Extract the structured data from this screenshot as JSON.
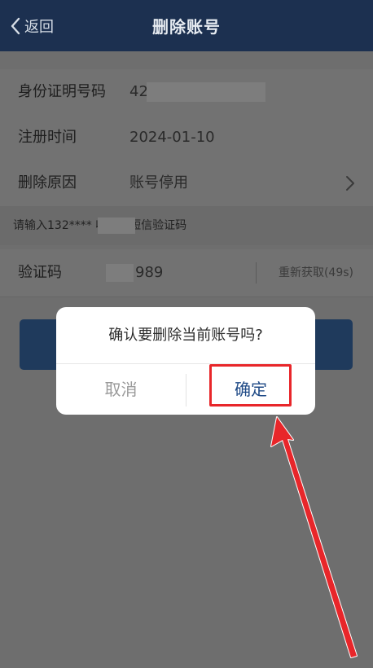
{
  "header": {
    "back_label": "返回",
    "title": "删除账号"
  },
  "form": {
    "id_number": {
      "label": "身份证明号码",
      "value": "42"
    },
    "register_time": {
      "label": "注册时间",
      "value": "2024-01-10"
    },
    "delete_reason": {
      "label": "删除原因",
      "value": "账号停用"
    },
    "sms_hint": "请输入132****      收到的短信验证码",
    "verify_code": {
      "label": "验证码",
      "value": "989",
      "resend_label": "重新获取(49s)"
    }
  },
  "dialog": {
    "message": "确认要删除当前账号吗?",
    "cancel_label": "取消",
    "confirm_label": "确定"
  },
  "colors": {
    "header_bg": "#1c3050",
    "confirm_text": "#1f4a86",
    "highlight": "#e8262a"
  }
}
